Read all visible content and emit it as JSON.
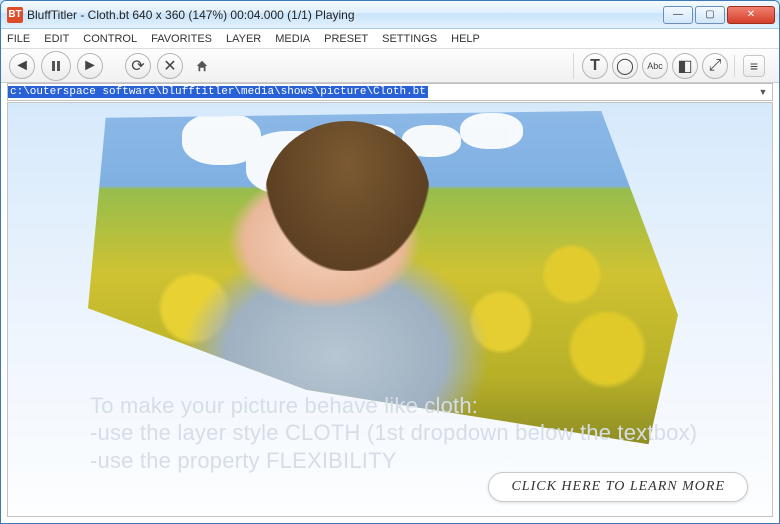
{
  "titlebar": {
    "icon_text": "BT",
    "title": "BluffTitler - Cloth.bt 640 x 360 (147%) 00:04.000 (1/1) Playing"
  },
  "menu": {
    "items": [
      "FILE",
      "EDIT",
      "CONTROL",
      "FAVORITES",
      "LAYER",
      "MEDIA",
      "PRESET",
      "SETTINGS",
      "HELP"
    ]
  },
  "toolbar": {
    "back": "◄",
    "pause": "pause",
    "forward": "►",
    "reload": "⟳",
    "stop": "✕",
    "home": "⌂",
    "text_tool": "T",
    "circle_tool": "◯",
    "abc_tool": "Abc",
    "outline_tool": "◧",
    "zoom_tool": "⤢",
    "menu_btn": "≡"
  },
  "pathbar": {
    "value": "c:\\outerspace software\\blufftitler\\media\\shows\\picture\\Cloth.bt"
  },
  "hint": {
    "line1": "To make your picture behave like cloth:",
    "line2": "-use the layer style CLOTH (1st dropdown below the textbox)",
    "line3": "-use the property FLEXIBILITY"
  },
  "learn_more": {
    "label": "CLICK HERE TO LEARN MORE"
  },
  "window_buttons": {
    "min": "—",
    "max": "▢",
    "close": "✕"
  }
}
